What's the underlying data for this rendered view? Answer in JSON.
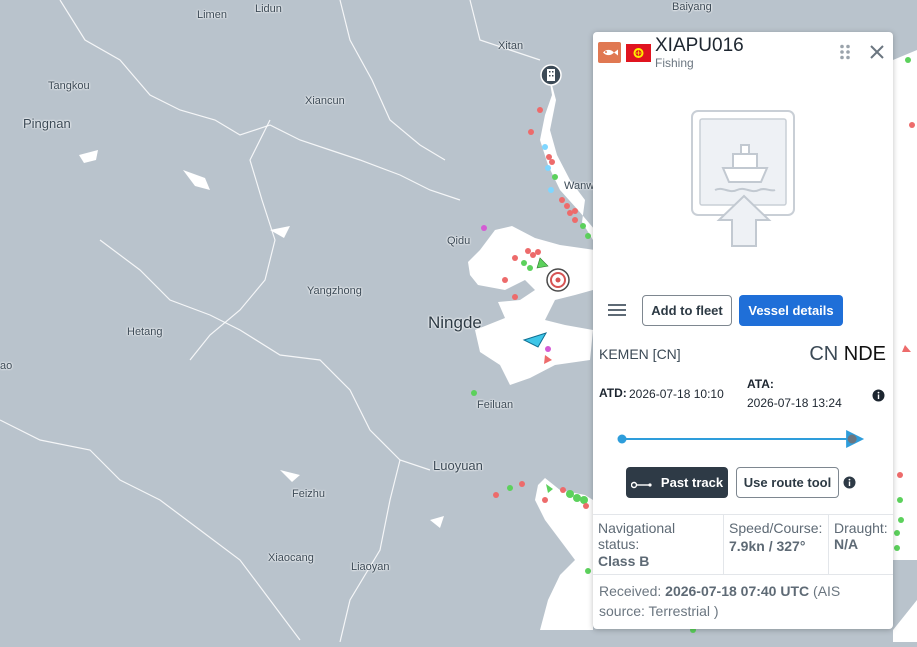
{
  "map": {
    "places": {
      "limen": "Limen",
      "lidun": "Lidun",
      "baiyang": "Baiyang",
      "xitan": "Xitan",
      "tangkou": "Tangkou",
      "xiancun": "Xiancun",
      "pingnan": "Pingnan",
      "wanw": "Wanw",
      "qidu": "Qidu",
      "yangzhong": "Yangzhong",
      "ningde": "Ningde",
      "hetang": "Hetang",
      "ao": "ao",
      "feiluan": "Feiluan",
      "luoyuan": "Luoyuan",
      "feizhu": "Feizhu",
      "xiaocang": "Xiaocang",
      "liaoyan": "Liaoyan"
    }
  },
  "panel": {
    "vessel_name": "XIAPU016",
    "vessel_type": "Fishing",
    "icons": {
      "type": "fishing-vessel-icon",
      "flag": "kyrgyzstan-flag-icon",
      "drag": "drag-handle-icon",
      "close": "close-icon",
      "photo": "vessel-placeholder-icon",
      "menu": "hamburger-menu-icon",
      "track": "past-track-icon",
      "info": "info-icon"
    },
    "buttons": {
      "add_to_fleet": "Add to fleet",
      "vessel_details": "Vessel details",
      "past_track": "Past track",
      "route_tool": "Use route tool"
    },
    "voyage": {
      "from": "KEMEN [CN]",
      "to_country": "CN",
      "to_code": "NDE",
      "atd_label": "ATD:",
      "atd_value": "2026-07-18 10:10",
      "ata_label": "ATA:",
      "ata_value": "2026-07-18 13:24",
      "progress": 0.93
    },
    "status": {
      "nav_label": "Navigational status:",
      "nav_value": "Class B",
      "speed_label": "Speed/Course:",
      "speed_value": "7.9kn / 327°",
      "draught_label": "Draught:",
      "draught_value": "N/A"
    },
    "received": {
      "label": "Received:",
      "time": "2026-07-18 07:40 UTC",
      "source": "(AIS source: Terrestrial )"
    }
  },
  "colors": {
    "sea": "#ffffff",
    "land": "#b9c3cc",
    "accent": "#1f6fd8",
    "track": "#2e9ddb",
    "fishing": "#e07852"
  }
}
